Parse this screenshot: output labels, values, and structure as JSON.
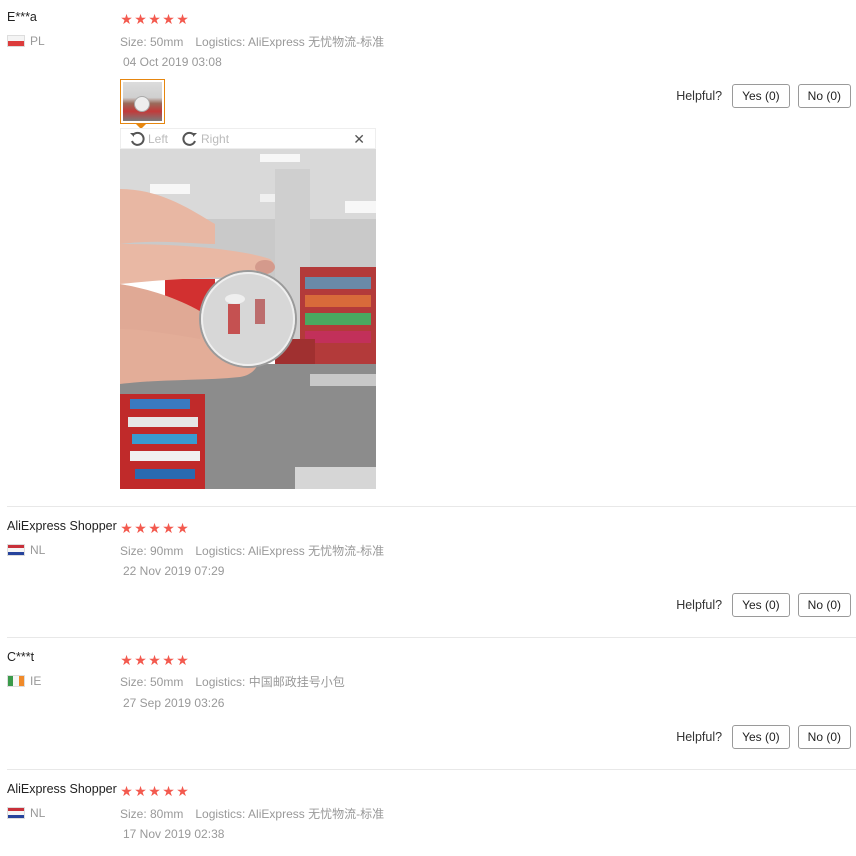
{
  "reviews": [
    {
      "name": "E***a",
      "country": "PL",
      "stars": 5,
      "size": "Size: 50mm",
      "logistics": "Logistics: AliExpress 无忧物流-标准",
      "date": "04 Oct 2019 03:08",
      "helpful_label": "Helpful?",
      "yes_label": "Yes (0)",
      "no_label": "No (0)"
    },
    {
      "name": "AliExpress Shopper",
      "country": "NL",
      "stars": 5,
      "size": "Size: 90mm",
      "logistics": "Logistics: AliExpress 无忧物流-标准",
      "date": "22 Nov 2019 07:29",
      "helpful_label": "Helpful?",
      "yes_label": "Yes (0)",
      "no_label": "No (0)"
    },
    {
      "name": "C***t",
      "country": "IE",
      "stars": 5,
      "size": "Size: 50mm",
      "logistics": "Logistics: 中国邮政挂号小包",
      "date": "27 Sep 2019 03:26",
      "helpful_label": "Helpful?",
      "yes_label": "Yes (0)",
      "no_label": "No (0)"
    },
    {
      "name": "AliExpress Shopper",
      "country": "NL",
      "stars": 5,
      "size": "Size: 80mm",
      "logistics": "Logistics: AliExpress 无忧物流-标准",
      "date": "17 Nov 2019 02:38"
    }
  ],
  "viewer": {
    "rotate_left": "Left",
    "rotate_right": "Right",
    "close_icon": "close-icon",
    "rotate_left_icon": "rotate-left-icon",
    "rotate_right_icon": "rotate-right-icon"
  },
  "colors": {
    "star": "#f35a4f",
    "thumb_border": "#e6860f"
  }
}
